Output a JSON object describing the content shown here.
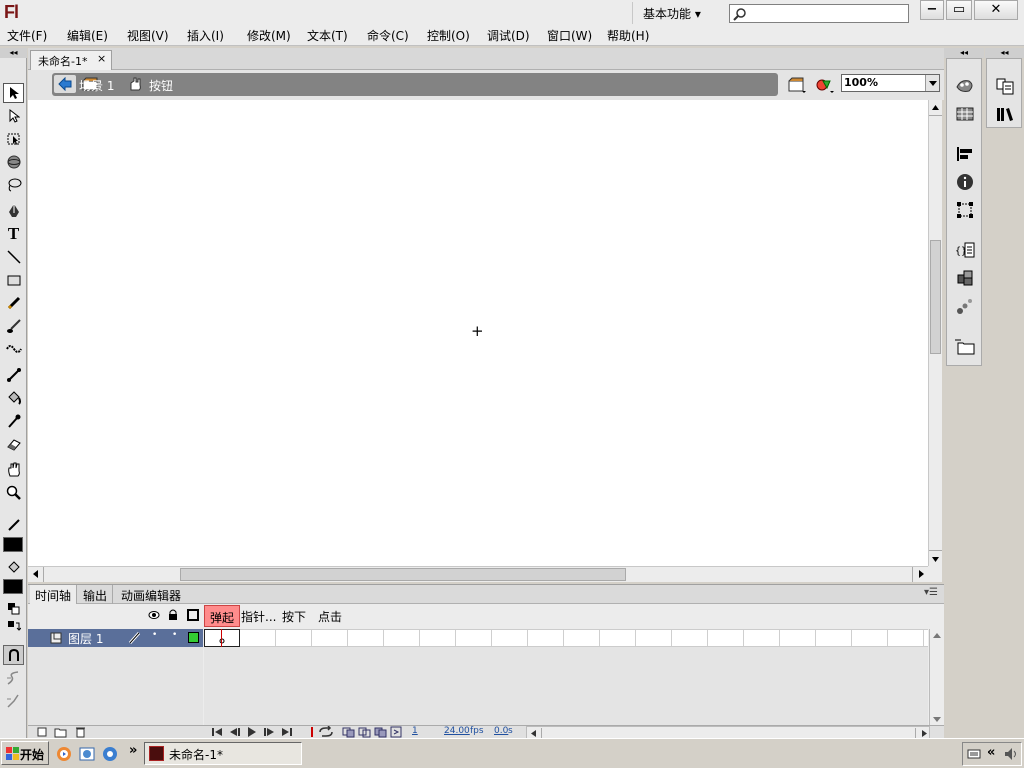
{
  "app": {
    "logo": "Fl",
    "workspace": "基本功能 ▾",
    "window_controls": [
      "−",
      "▭",
      "✕"
    ]
  },
  "menu": [
    "文件(F)",
    "编辑(E)",
    "视图(V)",
    "插入(I)",
    "修改(M)",
    "文本(T)",
    "命令(C)",
    "控制(O)",
    "调试(D)",
    "窗口(W)",
    "帮助(H)"
  ],
  "document": {
    "tab_label": "未命名-1*",
    "close": "×"
  },
  "editbar": {
    "scene_label": "场景 1",
    "symbol_label": "按钮",
    "zoom": "100%"
  },
  "stage": {
    "registration_mark": "+"
  },
  "panel_tabs": [
    "时间轴",
    "输出",
    "动画编辑器"
  ],
  "timeline": {
    "frame_labels": [
      "弹起",
      "指针...",
      "按下",
      "点击"
    ],
    "layer_name": "图层 1",
    "status": {
      "frame": "1",
      "fps": "24.00",
      "fps_unit": "fps",
      "time": "0.0",
      "time_unit": "s"
    }
  },
  "taskbar": {
    "start_label": "开始",
    "window_item": "未命名-1*",
    "chevron": "»"
  },
  "colors": {
    "stroke": "#000000",
    "fill": "#000000",
    "active_frame_label_bg": "#ff8c8c",
    "playhead": "#cc0000",
    "layer_row_bg": "#5a6f9a",
    "layer_color": "#33cc33"
  }
}
